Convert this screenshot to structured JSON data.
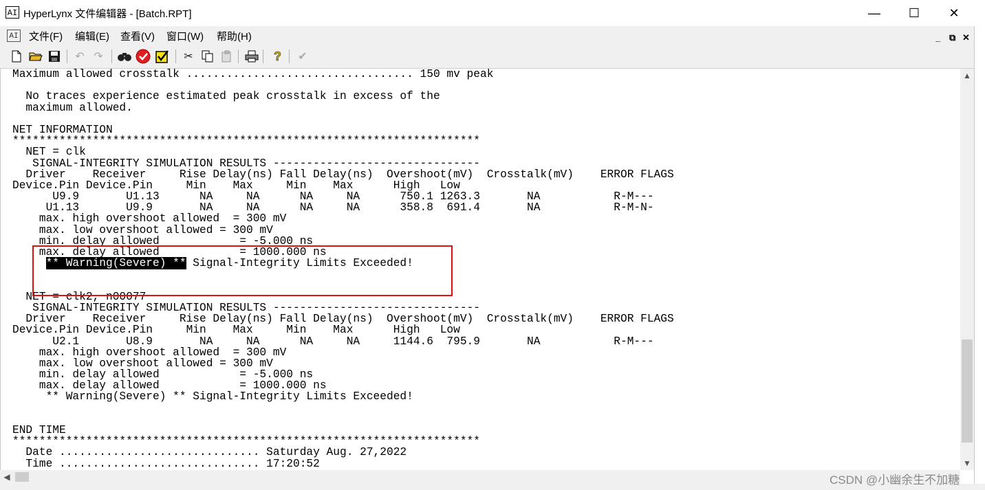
{
  "window": {
    "title": "HyperLynx 文件编辑器 - [Batch.RPT]",
    "app_icon_text": "AI",
    "minimize": "—",
    "maximize": "☐",
    "close": "✕"
  },
  "menu": {
    "doc_icon_text": "AI",
    "items": [
      "文件(F)",
      "编辑(E)",
      "查看(V)",
      "窗口(W)",
      "帮助(H)"
    ],
    "mdi": {
      "minimize": "_",
      "restore": "⧉",
      "close": "✕"
    }
  },
  "toolbar": {
    "icons": [
      "new-file-icon",
      "open-folder-icon",
      "save-icon",
      "undo-icon",
      "redo-icon",
      "find-icon",
      "stop-icon",
      "checkbox-icon",
      "cut-icon",
      "copy-icon",
      "paste-icon",
      "print-icon",
      "help-icon",
      "check-icon"
    ]
  },
  "report": {
    "lines": [
      "Maximum allowed crosstalk .................................. 150 mv peak",
      "",
      "  No traces experience estimated peak crosstalk in excess of the",
      "  maximum allowed.",
      "",
      "NET INFORMATION",
      "**********************************************************************",
      "  NET = clk",
      "   SIGNAL-INTEGRITY SIMULATION RESULTS -------------------------------",
      "  Driver    Receiver     Rise Delay(ns) Fall Delay(ns)  Overshoot(mV)  Crosstalk(mV)    ERROR FLAGS",
      "Device.Pin Device.Pin     Min    Max     Min    Max      High   Low",
      "      U9.9       U1.13      NA     NA      NA     NA      750.1 1263.3       NA           R-M---",
      "     U1.13       U9.9       NA     NA      NA     NA      358.8  691.4       NA           R-M-N-",
      "    max. high overshoot allowed  = 300 mV",
      "    max. low overshoot allowed = 300 mV",
      "    min. delay allowed            = -5.000 ns",
      "    max. delay allowed            = 1000.000 ns",
      "",
      "",
      "",
      "  NET = clk2, n00077",
      "   SIGNAL-INTEGRITY SIMULATION RESULTS -------------------------------",
      "  Driver    Receiver     Rise Delay(ns) Fall Delay(ns)  Overshoot(mV)  Crosstalk(mV)    ERROR FLAGS",
      "Device.Pin Device.Pin     Min    Max     Min    Max      High   Low",
      "      U2.1       U8.9       NA     NA      NA     NA     1144.6  795.9       NA           R-M---",
      "    max. high overshoot allowed  = 300 mV",
      "    max. low overshoot allowed = 300 mV",
      "    min. delay allowed            = -5.000 ns",
      "    max. delay allowed            = 1000.000 ns",
      "     ** Warning(Severe) ** Signal-Integrity Limits Exceeded!",
      "",
      "",
      "END TIME",
      "**********************************************************************",
      "  Date .............................. Saturday Aug. 27,2022",
      "  Time .............................. 17:20:52"
    ],
    "warning_selected": "** Warning(Severe) **",
    "warning_rest": " Signal-Integrity Limits Exceeded!",
    "warning_indent": "     "
  },
  "watermark": "CSDN @小幽余生不加糖",
  "colors": {
    "highlight_box": "#e01010",
    "selection_bg": "#000000"
  }
}
